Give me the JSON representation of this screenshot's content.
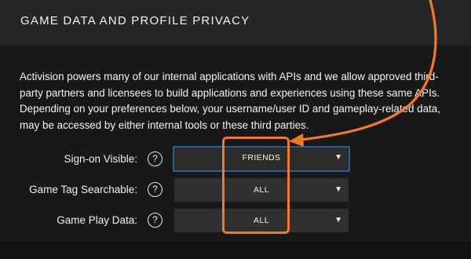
{
  "header": {
    "title": "GAME DATA AND PROFILE PRIVACY"
  },
  "description": "Activision powers many of our internal applications with APIs and we allow approved third-party partners and licensees to build applications and experiences using these same APIs. Depending on your preferences below, your username/user ID and gameplay-related data, may be accessed by either internal tools or these third parties.",
  "settings": [
    {
      "label": "Sign-on Visible:",
      "help_icon": "question-circle-icon",
      "value": "FRIENDS",
      "chevron": "▼"
    },
    {
      "label": "Game Tag Searchable:",
      "help_icon": "question-circle-icon",
      "value": "ALL",
      "chevron": "▼"
    },
    {
      "label": "Game Play Data:",
      "help_icon": "question-circle-icon",
      "value": "ALL",
      "chevron": "▼"
    }
  ],
  "help_glyph": "?",
  "colors": {
    "header_bg": "#262626",
    "body_bg": "#181818",
    "select_bg": "#303030",
    "focus_border": "#2b5b99",
    "annotation": "#f07a2a"
  }
}
